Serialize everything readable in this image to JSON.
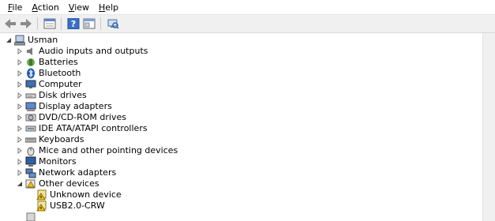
{
  "menubar": {
    "file_accel": "F",
    "file_rest": "ile",
    "action_accel": "A",
    "action_rest": "ction",
    "view_accel": "V",
    "view_rest": "iew",
    "help_accel": "H",
    "help_rest": "elp"
  },
  "toolbar": {
    "buttons": [
      "back-icon",
      "forward-icon",
      "properties-icon",
      "help-icon",
      "show-hide-icon",
      "scan-hardware-icon"
    ]
  },
  "tree": {
    "root": "Usman",
    "categories": [
      "Audio inputs and outputs",
      "Batteries",
      "Bluetooth",
      "Computer",
      "Disk drives",
      "Display adapters",
      "DVD/CD-ROM drives",
      "IDE ATA/ATAPI controllers",
      "Keyboards",
      "Mice and other pointing devices",
      "Monitors",
      "Network adapters",
      "Other devices"
    ],
    "other_devices": [
      "Unknown device",
      "USB2.0-CRW"
    ]
  },
  "colors": {
    "warning": "#f0c419",
    "bluetooth": "#1c5db5",
    "folder": "#e8c66a"
  }
}
